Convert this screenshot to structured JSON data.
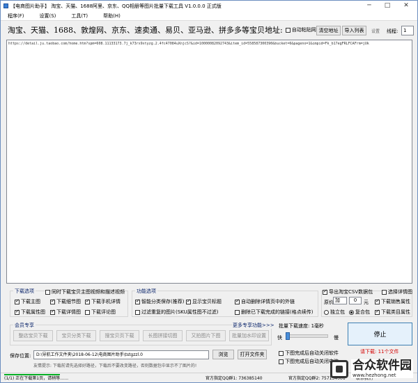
{
  "window": {
    "title": "【电商图片助手】 淘宝、天猫、1688阿里、京东、QQ相册等图片批量下载工具 V1.0.0.0 正式版"
  },
  "menu": [
    "程序(F)",
    "设置(S)",
    "工具(T)",
    "帮助(H)"
  ],
  "address_bar": {
    "label": "淘宝、天猫、1688、敦煌网、京东、速卖通、易贝、亚马逊、拼多多等宝贝地址:",
    "auto_detect": "自动粘贴网址",
    "clear_btn": "清空地址",
    "import_btn": "导入列表",
    "settings": "设置",
    "threads_label": "线程:",
    "threads_value": "1"
  },
  "url_text": "https://detail.ju.taobao.com/home.htm?spm=608.11133173.7j_k73rx9xtyzg.2.4fc47084uXnjcS?&id=10000082092743&item_id=558587300390&bucket=6&pageno=1&impid=Fk_b17egFRLFCAFrm=jUk",
  "download_options": {
    "title": "下载选项",
    "also_download": "同时下载宝贝主图视频和描述视频",
    "main_img": "下载主图",
    "detail_img": "下载细节图",
    "mobile_detail": "下载手机详情",
    "attr_img": "下载属性图",
    "desc_img": "下载详情图",
    "review_img": "下载评论图"
  },
  "function_options": {
    "title": "功能选项",
    "classify": "智能分类保存(推荐)",
    "show_title": "显示宝贝标题",
    "auto_delete": "自动删除详情页中的外链",
    "filter_dup": "过滤重复的图片(SKU属性图不过滤)",
    "del_done": "删除已下载完成的链接(格点续传)"
  },
  "csv_options": {
    "export_csv": "导出淘宝CSV数据包",
    "detail_img": "选择详情图",
    "price_label": "原价",
    "price_op": "加",
    "price_value": "0",
    "price_unit": "元",
    "sales_attr": "下载销售属性",
    "single_pack": "独立包",
    "merge_pack": "复合包",
    "all_attr": "下载类目属性"
  },
  "vip": {
    "title": "会员专享",
    "more": "更多专享功能>>>",
    "buttons": [
      "整店宝贝下载",
      "宝贝分类下载",
      "搜宝贝页下载",
      "长图拼接切图",
      "又拍图片下图",
      "批量加水印设置"
    ]
  },
  "speed": {
    "label": "批量下载速度: 1毫秒",
    "fast": "快",
    "slow": "慢"
  },
  "stop_btn": "停止",
  "download_tip": "请下载: 11个文件",
  "save": {
    "label": "保存位置:",
    "path": "D:\\导航工作文件夹\\2018-06-12\\电商图片助手\\tstgzzl.0",
    "browse": "浏览",
    "open": "打开文件夹",
    "after_done1": "下图完成后自动关闭软件",
    "after_done2": "下图完成后自动关闭电脑"
  },
  "tip": "友情提示: 下载前请先选择好路径，下载后不要改变路径，否则数据包中显示不了图片的!",
  "status": {
    "progress": "(1/1) 正在下载第1页，请稍等……",
    "qq1": "官方指定QQ群1: 736385140",
    "qq2": "官方指定QQ群2: 757154006",
    "right": "联系我们"
  },
  "watermark": {
    "brand": "合众软件园",
    "url": "www.hezhong.net"
  }
}
